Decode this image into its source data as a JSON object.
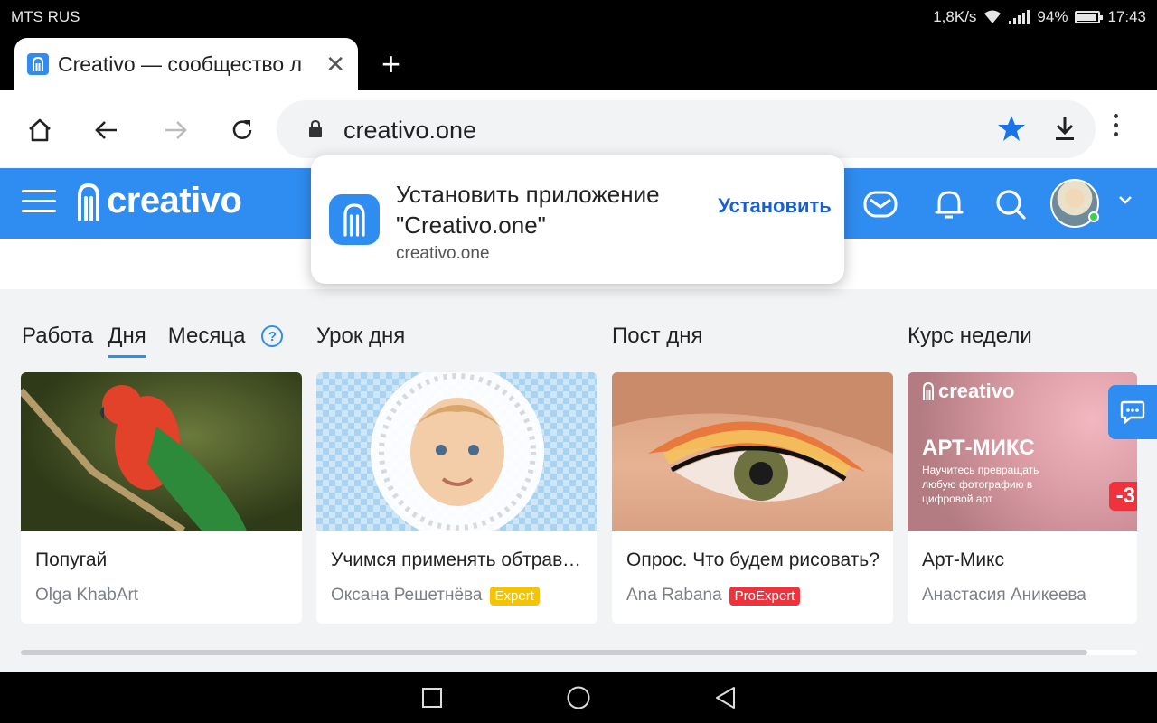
{
  "status_bar": {
    "carrier": "MTS RUS",
    "net_speed": "1,8K/s",
    "battery": "94%",
    "battery_level": 0.94,
    "time": "17:43"
  },
  "browser": {
    "tab_title": "Creativo — сообщество л",
    "url": "creativo.one"
  },
  "site": {
    "logo_text": "creativo"
  },
  "install_prompt": {
    "title": "Установить приложение \"Creativo.one\"",
    "site": "creativo.one",
    "install_label": "Установить"
  },
  "sections": {
    "work_label": "Работа",
    "day_tab": "Дня",
    "month_tab": "Месяца",
    "help": "?",
    "lesson_day": "Урок дня",
    "post_day": "Пост дня",
    "course_week": "Курс недели"
  },
  "cards": [
    {
      "title": "Попугай",
      "author": "Olga KhabArt",
      "badge": ""
    },
    {
      "title": "Учимся применять обтравочные маски",
      "author": "Оксана Решетнёва",
      "badge": "Expert"
    },
    {
      "title": "Опрос. Что будем рисовать?",
      "author": "Ana Rabana",
      "badge": "ProExpert"
    },
    {
      "title": "Арт-Микс",
      "author": "Анастасия Аникеева",
      "badge": ""
    }
  ],
  "promo": {
    "brand": "creativo",
    "headline": "АРТ-МИКС",
    "text": "Научитесь превращать любую фотографию в цифровой арт",
    "discount": "-3"
  },
  "colors": {
    "accent": "#2f8cf0",
    "expert_badge": "#f5c400",
    "proexpert_badge": "#f0323c"
  }
}
